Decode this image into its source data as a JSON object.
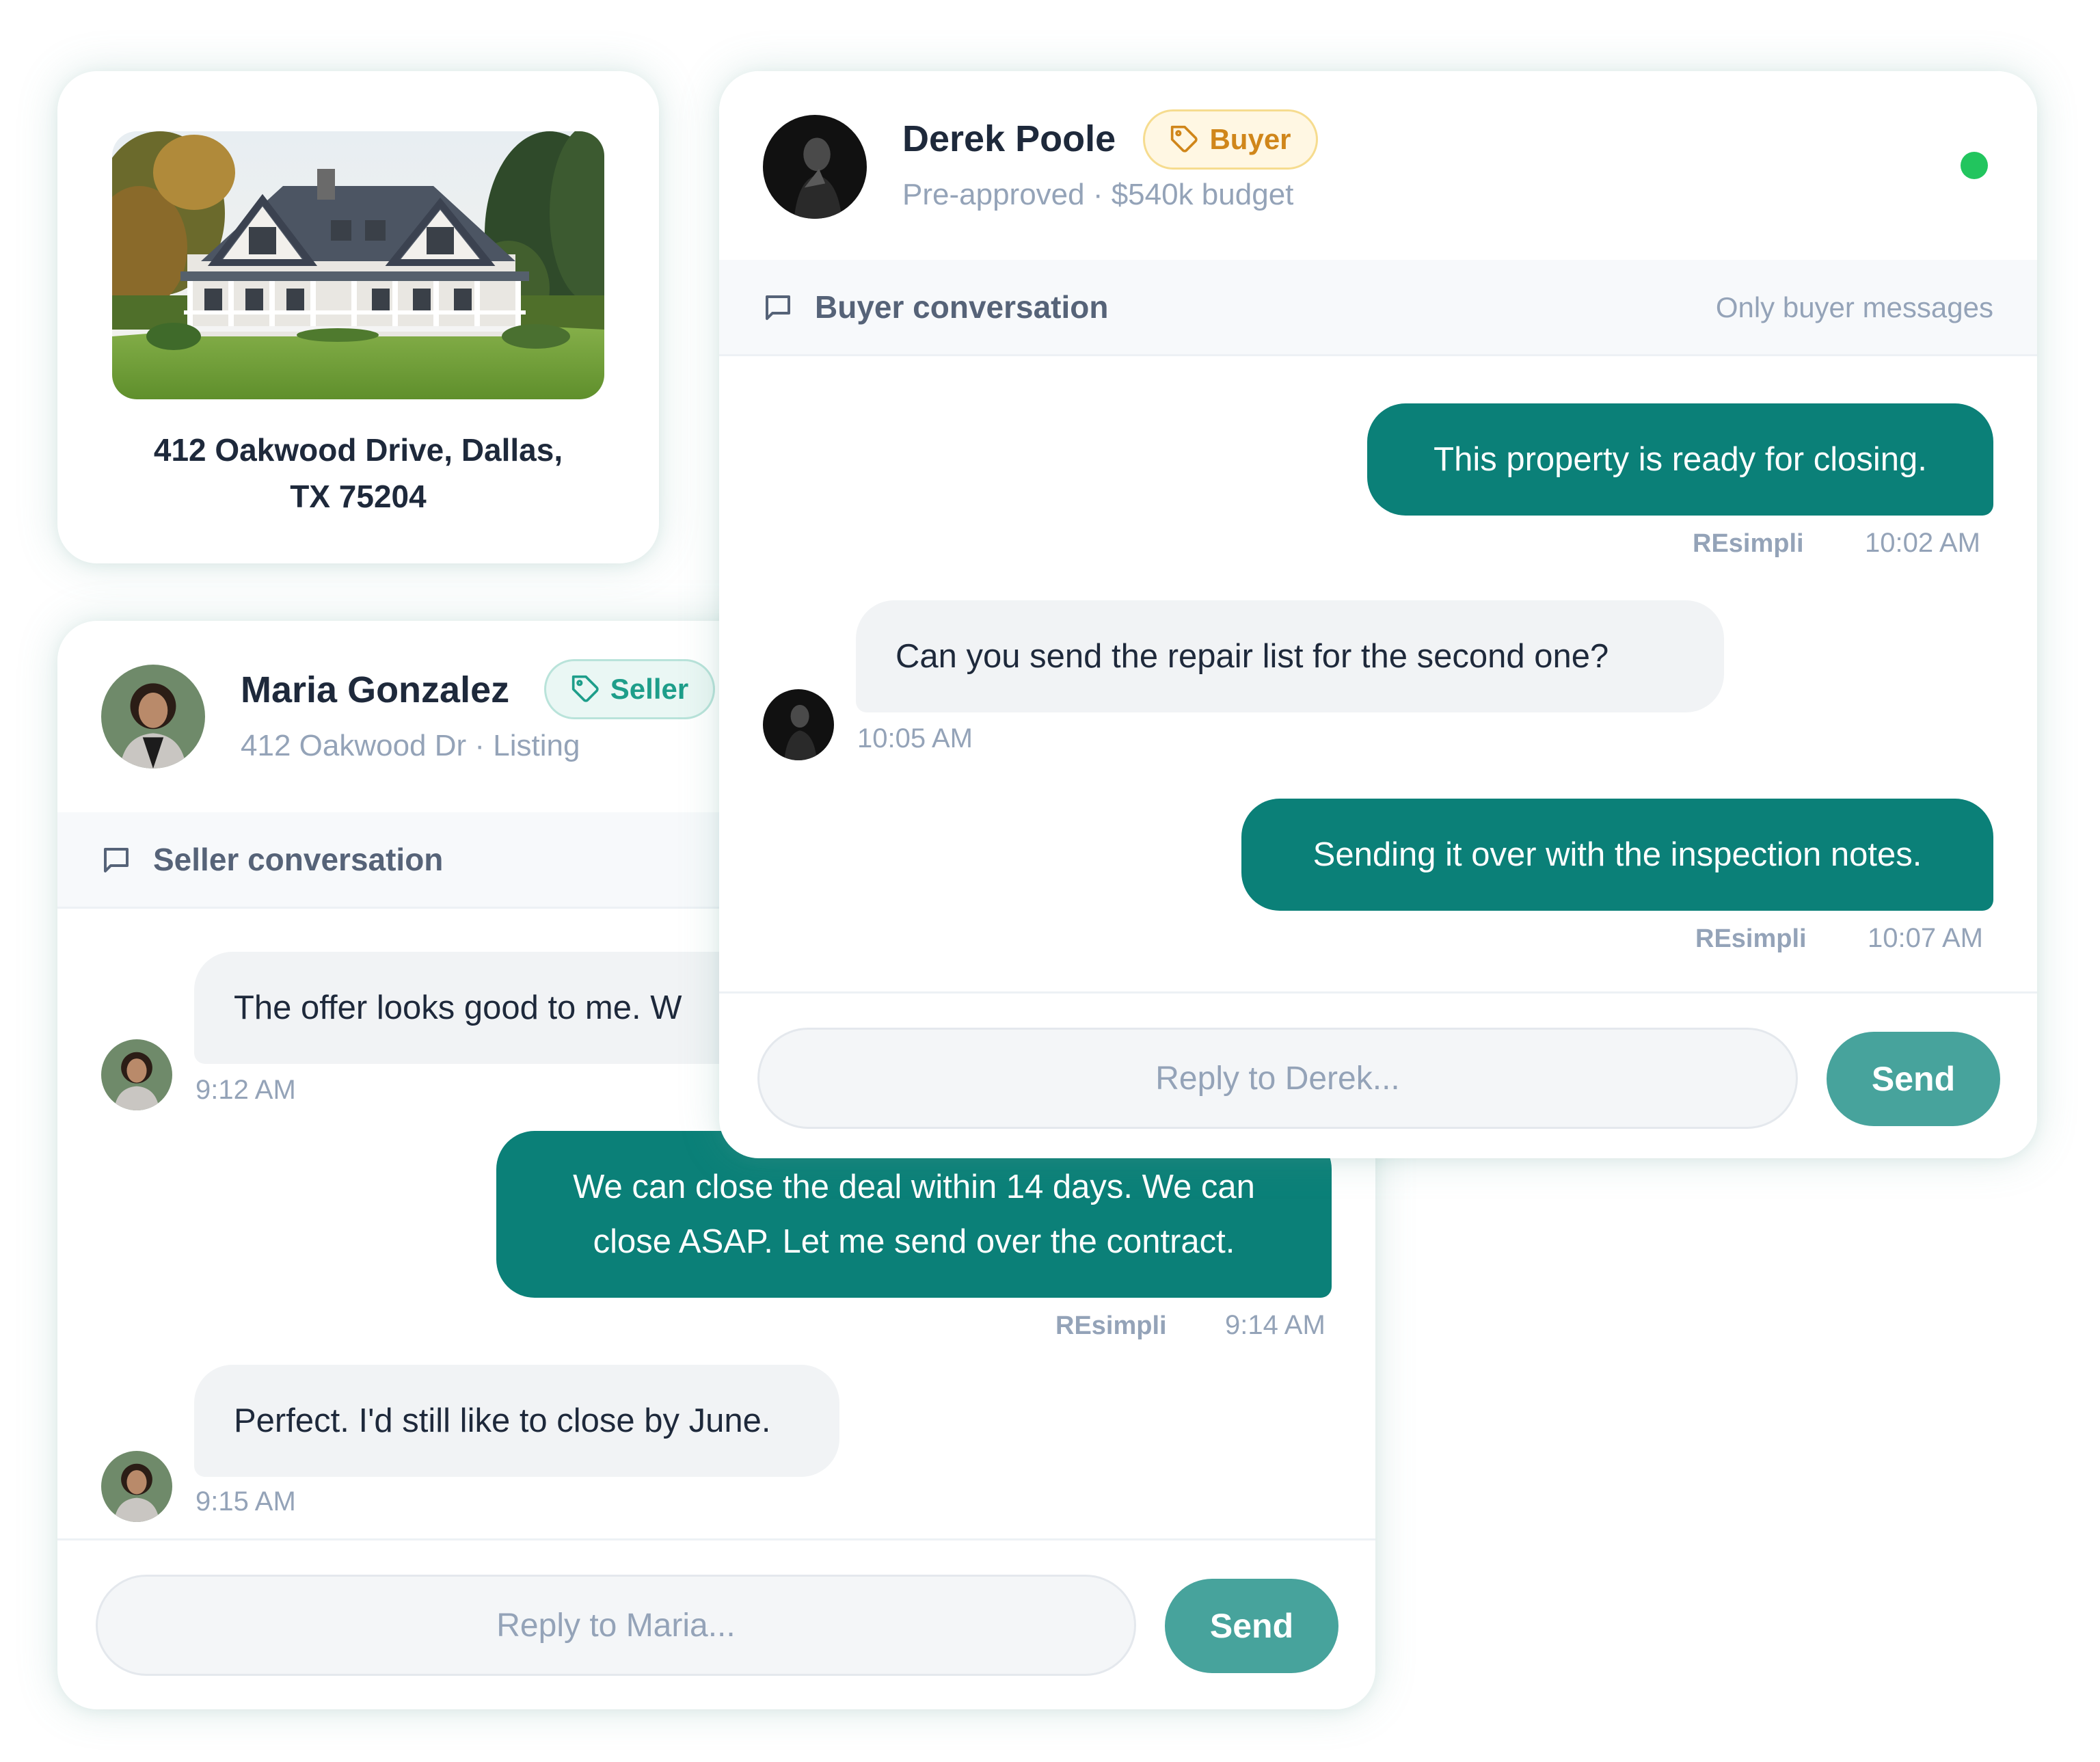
{
  "property": {
    "address_line1": "412 Oakwood Drive, Dallas,",
    "address_line2": "TX 75204"
  },
  "seller_chat": {
    "contact_name": "Maria Gonzalez",
    "tag_label": "Seller",
    "subtitle": "412 Oakwood Dr · Listing",
    "conversation_title": "Seller conversation",
    "messages": [
      {
        "direction": "in",
        "text": "The offer looks good to me. W",
        "time": "9:12 AM"
      },
      {
        "direction": "out",
        "lines": [
          "We can close the deal within 14 days. We can",
          "close ASAP. Let me send over the contract."
        ],
        "sender": "REsimpli",
        "time": "9:14 AM"
      },
      {
        "direction": "in",
        "text": "Perfect. I'd still like to close by June.",
        "time": "9:15 AM"
      }
    ],
    "reply_placeholder": "Reply to Maria...",
    "send_label": "Send"
  },
  "buyer_chat": {
    "contact_name": "Derek Poole",
    "tag_label": "Buyer",
    "subtitle": "Pre-approved · $540k budget",
    "status_color": "#22c55e",
    "conversation_title": "Buyer conversation",
    "conversation_note": "Only buyer messages",
    "messages": [
      {
        "direction": "out",
        "text": "This property is ready for closing.",
        "sender": "REsimpli",
        "time": "10:02 AM"
      },
      {
        "direction": "in",
        "text": "Can you send the repair list for the second one?",
        "time": "10:05 AM"
      },
      {
        "direction": "out",
        "text": "Sending it over with the inspection notes.",
        "sender": "REsimpli",
        "time": "10:07 AM"
      }
    ],
    "reply_placeholder": "Reply to Derek...",
    "send_label": "Send"
  },
  "colors": {
    "outgoing_bubble": "#0b8078",
    "send_button": "#47a39c",
    "seller_tag": "#1e9e8a",
    "buyer_tag": "#d0861a"
  },
  "icons": [
    "tag-icon",
    "chat-bubble-icon"
  ]
}
